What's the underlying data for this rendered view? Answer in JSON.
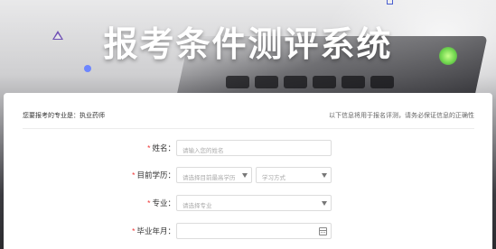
{
  "hero": {
    "title": "报考条件测评系统"
  },
  "panel": {
    "major_prefix": "您要报考的专业是：",
    "major_value": "执业药师",
    "notice": "以下信息将用于报名评测，请务必保证信息的正确性"
  },
  "form": {
    "name": {
      "required_mark": "*",
      "label": "姓名：",
      "placeholder": "请输入您的姓名"
    },
    "education": {
      "required_mark": "*",
      "label": "目前学历：",
      "placeholder": "请选择目前最高学历",
      "mode_placeholder": "学习方式"
    },
    "major": {
      "required_mark": "*",
      "label": "专业：",
      "placeholder": "请选择专业"
    },
    "graduation": {
      "required_mark": "*",
      "label": "毕业年月：",
      "value": ""
    }
  },
  "icons": {
    "select_arrow": "chevron-down-icon",
    "calendar": "calendar-icon"
  },
  "colors": {
    "required": "#ee3333",
    "deco_purple": "#6e4fb4",
    "deco_blue": "#6d86ff",
    "deco_green": "#6ad34a"
  }
}
